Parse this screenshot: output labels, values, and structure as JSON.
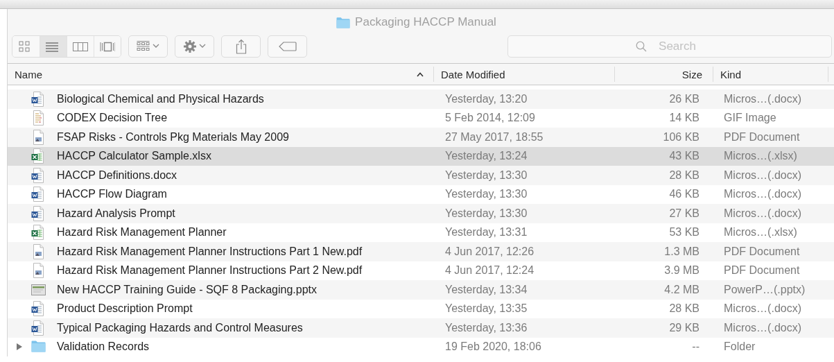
{
  "window": {
    "title": "Packaging HACCP Manual"
  },
  "toolbar": {
    "view_modes": [
      {
        "kind": "icons",
        "selected": false
      },
      {
        "kind": "list",
        "selected": true
      },
      {
        "kind": "columns",
        "selected": false
      },
      {
        "kind": "gallery",
        "selected": false
      }
    ],
    "buttons": [
      {
        "kind": "group"
      },
      {
        "kind": "action"
      },
      {
        "kind": "share"
      },
      {
        "kind": "tag"
      }
    ]
  },
  "search": {
    "placeholder": "Search"
  },
  "columns": [
    {
      "label": "Name",
      "sorted": true
    },
    {
      "label": "Date Modified",
      "sorted": false
    },
    {
      "label": "Size",
      "sorted": false
    },
    {
      "label": "Kind",
      "sorted": false
    }
  ],
  "rows": [
    {
      "kind": "word",
      "name": "Biological Chemical and Physical Hazards",
      "date": "Yesterday, 13:20",
      "size": "26 KB",
      "type": "Micros…(.docx)",
      "selected": false
    },
    {
      "kind": "image",
      "name": "CODEX Decision Tree",
      "date": "5 Feb 2014, 12:09",
      "size": "14 KB",
      "type": "GIF Image",
      "selected": false
    },
    {
      "kind": "pdf",
      "name": "FSAP Risks - Controls Pkg Materials May 2009",
      "date": "27 May 2017, 18:55",
      "size": "106 KB",
      "type": "PDF Document",
      "selected": false
    },
    {
      "kind": "excel",
      "name": "HACCP Calculator Sample.xlsx",
      "date": "Yesterday, 13:24",
      "size": "43 KB",
      "type": "Micros…(.xlsx)",
      "selected": true
    },
    {
      "kind": "word",
      "name": "HACCP Definitions.docx",
      "date": "Yesterday, 13:30",
      "size": "28 KB",
      "type": "Micros…(.docx)",
      "selected": false
    },
    {
      "kind": "word",
      "name": "HACCP Flow Diagram",
      "date": "Yesterday, 13:30",
      "size": "46 KB",
      "type": "Micros…(.docx)",
      "selected": false
    },
    {
      "kind": "word",
      "name": "Hazard Analysis Prompt",
      "date": "Yesterday, 13:30",
      "size": "27 KB",
      "type": "Micros…(.docx)",
      "selected": false
    },
    {
      "kind": "excel",
      "name": "Hazard Risk Management Planner",
      "date": "Yesterday, 13:31",
      "size": "53 KB",
      "type": "Micros…(.xlsx)",
      "selected": false
    },
    {
      "kind": "pdf",
      "name": "Hazard Risk Management Planner Instructions Part 1 New.pdf",
      "date": "4 Jun 2017, 12:26",
      "size": "1.3 MB",
      "type": "PDF Document",
      "selected": false
    },
    {
      "kind": "pdf",
      "name": "Hazard Risk Management Planner Instructions Part 2 New.pdf",
      "date": "4 Jun 2017, 12:24",
      "size": "3.9 MB",
      "type": "PDF Document",
      "selected": false
    },
    {
      "kind": "powerpoint",
      "name": "New HACCP Training Guide - SQF 8 Packaging.pptx",
      "date": "Yesterday, 13:34",
      "size": "4.2 MB",
      "type": "PowerP…(.pptx)",
      "selected": false
    },
    {
      "kind": "word",
      "name": "Product Description Prompt",
      "date": "Yesterday, 13:35",
      "size": "28 KB",
      "type": "Micros…(.docx)",
      "selected": false
    },
    {
      "kind": "word",
      "name": "Typical Packaging Hazards and Control Measures",
      "date": "Yesterday, 13:36",
      "size": "29 KB",
      "type": "Micros…(.docx)",
      "selected": false
    },
    {
      "kind": "folder",
      "name": "Validation Records",
      "date": "19 Feb 2020, 18:06",
      "size": "--",
      "type": "Folder",
      "selected": false,
      "expanded": false
    }
  ]
}
